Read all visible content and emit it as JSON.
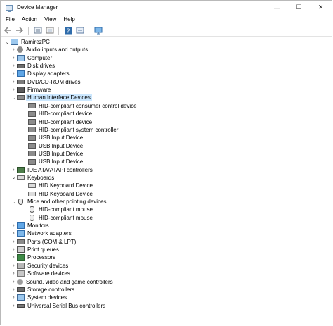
{
  "window": {
    "title": "Device Manager",
    "minimize": "—",
    "maximize": "☐",
    "close": "✕"
  },
  "menu": [
    "File",
    "Action",
    "View",
    "Help"
  ],
  "toolbar": [
    "back-icon",
    "forward-icon",
    "properties-icon",
    "show-hidden-icon",
    "help-icon",
    "update-driver-icon",
    "scan-hardware-icon"
  ],
  "tree": {
    "root": "RamirezPC",
    "categories": [
      {
        "label": "Audio inputs and outputs",
        "icon": "audio",
        "expanded": false
      },
      {
        "label": "Computer",
        "icon": "computer",
        "expanded": false
      },
      {
        "label": "Disk drives",
        "icon": "disk",
        "expanded": false
      },
      {
        "label": "Display adapters",
        "icon": "display",
        "expanded": false
      },
      {
        "label": "DVD/CD-ROM drives",
        "icon": "dvd",
        "expanded": false
      },
      {
        "label": "Firmware",
        "icon": "firmware",
        "expanded": false
      },
      {
        "label": "Human Interface Devices",
        "icon": "hid",
        "expanded": true,
        "selected": true,
        "children": [
          "HID-compliant consumer control device",
          "HID-compliant device",
          "HID-compliant device",
          "HID-compliant system controller",
          "USB Input Device",
          "USB Input Device",
          "USB Input Device",
          "USB Input Device"
        ]
      },
      {
        "label": "IDE ATA/ATAPI controllers",
        "icon": "ide",
        "expanded": false
      },
      {
        "label": "Keyboards",
        "icon": "keyboard",
        "expanded": true,
        "children": [
          "HID Keyboard Device",
          "HID Keyboard Device"
        ]
      },
      {
        "label": "Mice and other pointing devices",
        "icon": "mouse",
        "expanded": true,
        "children": [
          "HID-compliant mouse",
          "HID-compliant mouse"
        ]
      },
      {
        "label": "Monitors",
        "icon": "monitor",
        "expanded": false
      },
      {
        "label": "Network adapters",
        "icon": "network",
        "expanded": false
      },
      {
        "label": "Ports (COM & LPT)",
        "icon": "ports",
        "expanded": false
      },
      {
        "label": "Print queues",
        "icon": "print",
        "expanded": false
      },
      {
        "label": "Processors",
        "icon": "cpu",
        "expanded": false
      },
      {
        "label": "Security devices",
        "icon": "security",
        "expanded": false
      },
      {
        "label": "Software devices",
        "icon": "software",
        "expanded": false
      },
      {
        "label": "Sound, video and game controllers",
        "icon": "sound",
        "expanded": false
      },
      {
        "label": "Storage controllers",
        "icon": "storage",
        "expanded": false
      },
      {
        "label": "System devices",
        "icon": "system",
        "expanded": false
      },
      {
        "label": "Universal Serial Bus controllers",
        "icon": "usb",
        "expanded": false
      }
    ]
  },
  "colors": {
    "selection": "#cce8ff",
    "accent": "#2f6cab"
  }
}
